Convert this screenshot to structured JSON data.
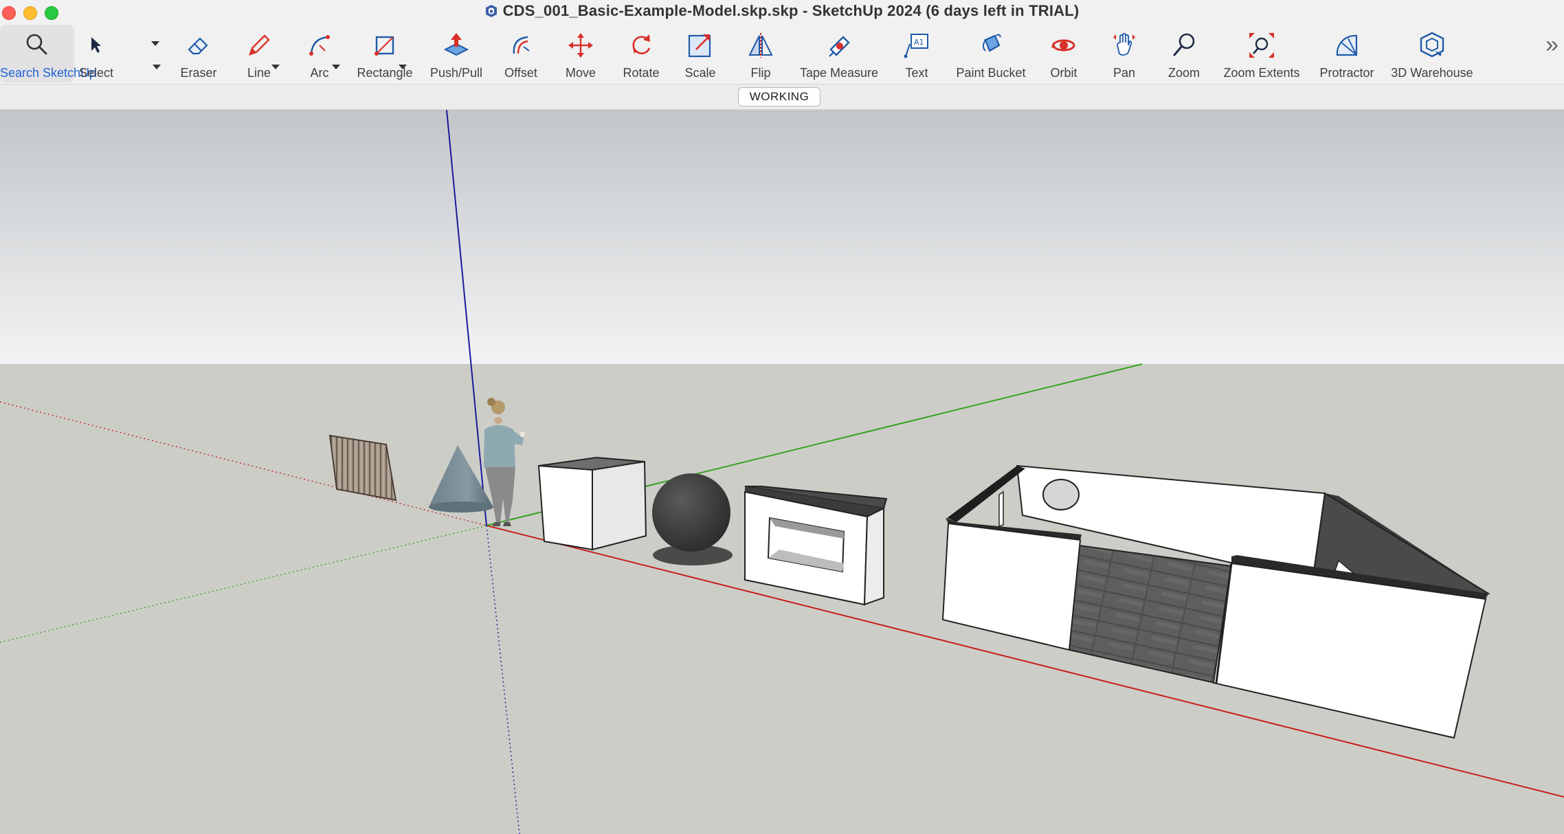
{
  "window": {
    "title": "CDS_001_Basic-Example-Model.skp.skp - SketchUp 2024 (6 days left in TRIAL)"
  },
  "toolbar": {
    "tools": [
      {
        "id": "search",
        "label": "Search SketchUp",
        "icon": "search-icon",
        "active": true
      },
      {
        "id": "select",
        "label": "Select",
        "icon": "select-arrow-icon"
      },
      {
        "id": "eraser",
        "label": "Eraser",
        "icon": "eraser-icon"
      },
      {
        "id": "line",
        "label": "Line",
        "icon": "pencil-icon"
      },
      {
        "id": "arc",
        "label": "Arc",
        "icon": "arc-icon"
      },
      {
        "id": "rectangle",
        "label": "Rectangle",
        "icon": "rectangle-icon"
      },
      {
        "id": "pushpull",
        "label": "Push/Pull",
        "icon": "push-pull-icon"
      },
      {
        "id": "offset",
        "label": "Offset",
        "icon": "offset-icon"
      },
      {
        "id": "move",
        "label": "Move",
        "icon": "move-icon"
      },
      {
        "id": "rotate",
        "label": "Rotate",
        "icon": "rotate-icon"
      },
      {
        "id": "scale",
        "label": "Scale",
        "icon": "scale-icon"
      },
      {
        "id": "flip",
        "label": "Flip",
        "icon": "flip-icon"
      },
      {
        "id": "tape",
        "label": "Tape Measure",
        "icon": "tape-measure-icon"
      },
      {
        "id": "text",
        "label": "Text",
        "icon": "text-icon"
      },
      {
        "id": "paint",
        "label": "Paint Bucket",
        "icon": "paint-bucket-icon"
      },
      {
        "id": "orbit",
        "label": "Orbit",
        "icon": "orbit-icon"
      },
      {
        "id": "pan",
        "label": "Pan",
        "icon": "pan-hand-icon"
      },
      {
        "id": "zoom",
        "label": "Zoom",
        "icon": "zoom-icon"
      },
      {
        "id": "zoomext",
        "label": "Zoom Extents",
        "icon": "zoom-extents-icon"
      },
      {
        "id": "protractor",
        "label": "Protractor",
        "icon": "protractor-icon"
      },
      {
        "id": "warehouse",
        "label": "3D Warehouse",
        "icon": "warehouse-icon"
      }
    ],
    "overflow": "»"
  },
  "status": {
    "working_label": "WORKING"
  },
  "viewport": {
    "sky_top": "#c2c6c9",
    "sky_bottom": "#f2f3f4",
    "ground": "#cdcdc8",
    "axis_red": "#c8201e",
    "axis_green": "#34a31f",
    "axis_blue": "#1a1a9a"
  },
  "colors": {
    "accent": "#2463d6",
    "tool_red": "#e0362f",
    "tool_blue": "#1e5aa8"
  }
}
